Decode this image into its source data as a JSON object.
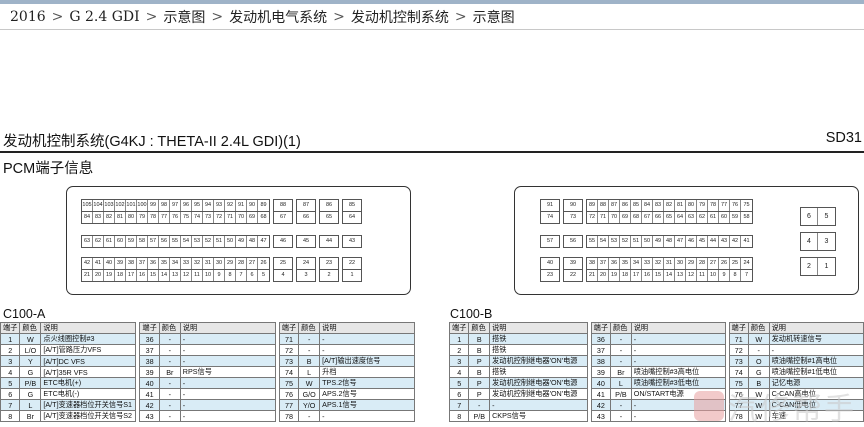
{
  "breadcrumb": [
    "2016",
    "G 2.4 GDI",
    "示意图",
    "发动机电气系统",
    "发动机控制系统",
    "示意图"
  ],
  "breadcrumb_sep": ">",
  "doc": {
    "title": "发动机控制系统(G4KJ : THETA-II 2.4L GDI)(1)",
    "code": "SD31",
    "subtitle": "PCM端子信息"
  },
  "connector_a": {
    "row1": [
      [
        "105",
        "104",
        "103",
        "102",
        "101",
        "100",
        "99",
        "98",
        "97",
        "96",
        "95",
        "94",
        "93",
        "92",
        "91",
        "90",
        "89"
      ],
      [
        "88"
      ],
      [
        "87"
      ],
      [
        "86"
      ],
      [
        "85"
      ]
    ],
    "row2": [
      [
        "84",
        "83",
        "82",
        "81",
        "80",
        "79",
        "78",
        "77",
        "76",
        "75",
        "74",
        "73",
        "72",
        "71",
        "70",
        "69",
        "68"
      ],
      [
        "67"
      ],
      [
        "66"
      ],
      [
        "65"
      ],
      [
        "64"
      ]
    ],
    "row3": [
      [
        "63",
        "62",
        "61",
        "60",
        "59",
        "58",
        "57",
        "56",
        "55",
        "54",
        "53",
        "52",
        "51",
        "50",
        "49",
        "48",
        "47"
      ],
      [
        "46"
      ],
      [
        "45"
      ],
      [
        "44"
      ],
      [
        "43"
      ]
    ],
    "row4": [
      [
        "42",
        "41",
        "40",
        "39",
        "38",
        "37",
        "36",
        "35",
        "34",
        "33",
        "32",
        "31",
        "30",
        "29",
        "28",
        "27",
        "26"
      ],
      [
        "25"
      ],
      [
        "24"
      ],
      [
        "23"
      ],
      [
        "22"
      ]
    ],
    "row5": [
      [
        "21",
        "20",
        "19",
        "18",
        "17",
        "16",
        "15",
        "14",
        "13",
        "12",
        "11",
        "10",
        "9",
        "8",
        "7",
        "6",
        "5"
      ],
      [
        "4"
      ],
      [
        "3"
      ],
      [
        "2"
      ],
      [
        "1"
      ]
    ]
  },
  "connector_b": {
    "row1": [
      [
        "91"
      ],
      [
        "90"
      ],
      [
        "89",
        "88",
        "87",
        "86",
        "85",
        "84",
        "83",
        "82",
        "81",
        "80",
        "79",
        "78",
        "77",
        "76",
        "75"
      ]
    ],
    "row2": [
      [
        "74"
      ],
      [
        "73"
      ],
      [
        "72",
        "71",
        "70",
        "69",
        "68",
        "67",
        "66",
        "65",
        "64",
        "63",
        "62",
        "61",
        "60",
        "59",
        "58"
      ]
    ],
    "row3": [
      [
        "57"
      ],
      [
        "56"
      ],
      [
        "55",
        "54",
        "53",
        "52",
        "51",
        "50",
        "49",
        "48",
        "47",
        "46",
        "45",
        "44",
        "43",
        "42",
        "41"
      ]
    ],
    "row4": [
      [
        "40"
      ],
      [
        "39"
      ],
      [
        "38",
        "37",
        "36",
        "35",
        "34",
        "33",
        "32",
        "31",
        "30",
        "29",
        "28",
        "27",
        "26",
        "25",
        "24"
      ]
    ],
    "row5": [
      [
        "23"
      ],
      [
        "22"
      ],
      [
        "21",
        "20",
        "19",
        "18",
        "17",
        "16",
        "15",
        "14",
        "13",
        "12",
        "11",
        "10",
        "9",
        "8",
        "7"
      ]
    ],
    "side": [
      [
        "6",
        "5"
      ],
      [
        "4",
        "3"
      ],
      [
        "2",
        "1"
      ]
    ]
  },
  "table_a": {
    "title": "C100-A",
    "headers": [
      "端子",
      "颜色",
      "说明"
    ],
    "rows": [
      [
        [
          "1",
          "W",
          "点火线圈控制#3"
        ],
        [
          "36",
          "-",
          "-"
        ],
        [
          "71",
          "-",
          "-"
        ]
      ],
      [
        [
          "2",
          "L/O",
          "[A/T]管路压力VFS"
        ],
        [
          "37",
          "-",
          "-"
        ],
        [
          "72",
          "-",
          "-"
        ]
      ],
      [
        [
          "3",
          "Y",
          "[A/T]DC VFS"
        ],
        [
          "38",
          "-",
          "-"
        ],
        [
          "73",
          "B",
          "[A/T]输出速度信号"
        ]
      ],
      [
        [
          "4",
          "G",
          "[A/T]35R VFS"
        ],
        [
          "39",
          "Br",
          "RPS信号"
        ],
        [
          "74",
          "L",
          "升档"
        ]
      ],
      [
        [
          "5",
          "P/B",
          "ETC电机(+)"
        ],
        [
          "40",
          "-",
          "-"
        ],
        [
          "75",
          "W",
          "TPS.2信号"
        ]
      ],
      [
        [
          "6",
          "G",
          "ETC电机(-)"
        ],
        [
          "41",
          "-",
          "-"
        ],
        [
          "76",
          "G/O",
          "APS.2信号"
        ]
      ],
      [
        [
          "7",
          "L",
          "[A/T]变速器档位开关信号S1"
        ],
        [
          "42",
          "-",
          "-"
        ],
        [
          "77",
          "Y/O",
          "APS.1信号"
        ]
      ],
      [
        [
          "8",
          "Br",
          "[A/T]变速器档位开关信号S2"
        ],
        [
          "43",
          "-",
          "-"
        ],
        [
          "78",
          "-",
          "-"
        ]
      ]
    ]
  },
  "table_b": {
    "title": "C100-B",
    "headers": [
      "端子",
      "颜色",
      "说明"
    ],
    "rows": [
      [
        [
          "1",
          "B",
          "搭铁"
        ],
        [
          "36",
          "-",
          "-"
        ],
        [
          "71",
          "W",
          "发动机转速信号"
        ]
      ],
      [
        [
          "2",
          "B",
          "搭铁"
        ],
        [
          "37",
          "-",
          "-"
        ],
        [
          "72",
          "-",
          "-"
        ]
      ],
      [
        [
          "3",
          "P",
          "发动机控制继电器'ON'电源"
        ],
        [
          "38",
          "-",
          "-"
        ],
        [
          "73",
          "O",
          "喷油嘴控制#1高电位"
        ]
      ],
      [
        [
          "4",
          "B",
          "搭铁"
        ],
        [
          "39",
          "Br",
          "喷油嘴控制#3高电位"
        ],
        [
          "74",
          "G",
          "喷油嘴控制#1低电位"
        ]
      ],
      [
        [
          "5",
          "P",
          "发动机控制继电器'ON'电源"
        ],
        [
          "40",
          "L",
          "喷油嘴控制#3低电位"
        ],
        [
          "75",
          "B",
          "记忆电源"
        ]
      ],
      [
        [
          "6",
          "P",
          "发动机控制继电器'ON'电源"
        ],
        [
          "41",
          "P/B",
          "ON/START电源"
        ],
        [
          "76",
          "W",
          "C-CAN高电位"
        ]
      ],
      [
        [
          "7",
          "-",
          "-"
        ],
        [
          "42",
          "-",
          "-"
        ],
        [
          "77",
          "W",
          "C-CAN低电位"
        ]
      ],
      [
        [
          "8",
          "P/B",
          "CKPS信号"
        ],
        [
          "43",
          "-",
          "-"
        ],
        [
          "78",
          "W",
          "车速"
        ]
      ]
    ]
  },
  "watermark": {
    "text": "汽修帮手"
  }
}
